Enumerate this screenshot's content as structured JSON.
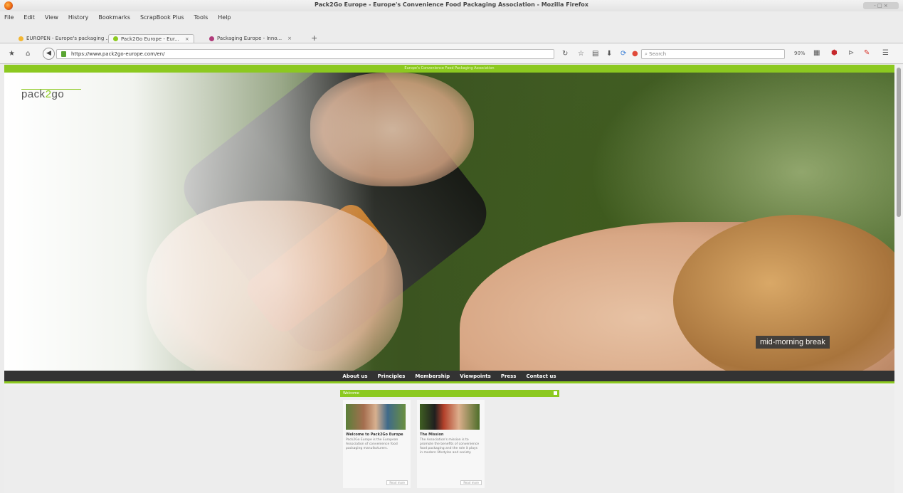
{
  "window": {
    "title": "Pack2Go Europe - Europe's Convenience Food Packaging Association - Mozilla Firefox",
    "controls_label": "- □ ×"
  },
  "menubar": [
    "File",
    "Edit",
    "View",
    "History",
    "Bookmarks",
    "ScrapBook Plus",
    "Tools",
    "Help"
  ],
  "tabs": [
    {
      "label": "EUROPEN - Europe's packaging ...",
      "close": "×",
      "color": "#f2b632"
    },
    {
      "label": "Pack2Go Europe - Eur...",
      "close": "×",
      "color": "#8cc920"
    },
    {
      "label": "Packaging Europe - Inno...",
      "close": "×",
      "color": "#b03a7a"
    }
  ],
  "new_tab": "+",
  "navbar": {
    "url": "https://www.pack2go-europe.com/en/",
    "search_placeholder": "Search",
    "zoom": "90%"
  },
  "page": {
    "top_strip": "Europe's Convenience Food Packaging Association",
    "logo_prefix": "pack",
    "logo_two": "2",
    "logo_suffix": "go",
    "hero_caption": "mid-morning break",
    "nav": [
      "About us",
      "Principles",
      "Membership",
      "Viewpoints",
      "Press",
      "Contact us"
    ],
    "section_title": "Welcome",
    "cards": [
      {
        "title": "Welcome to Pack2Go Europe",
        "text": "Pack2Go Europe is the European Association of convenience food packaging manufacturers.",
        "more": "Read more"
      },
      {
        "title": "The Mission",
        "text": "The Association's mission is to promote the benefits of convenience food packaging and the role it plays in modern lifestyles and society.",
        "more": "Read more"
      }
    ]
  },
  "colors": {
    "brand_green": "#8cc920",
    "nav_dark": "#333333"
  }
}
